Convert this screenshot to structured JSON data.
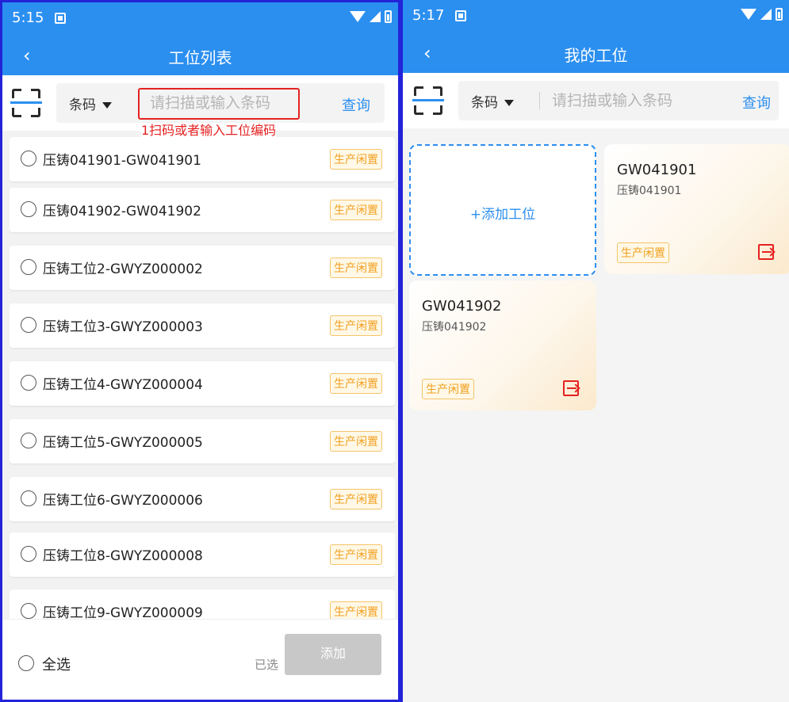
{
  "left": {
    "status": {
      "time": "5:15"
    },
    "nav": {
      "back": "‹",
      "title": "工位列表"
    },
    "search": {
      "type": "条码",
      "placeholder": "请扫描或输入条码",
      "query": "查询"
    },
    "annotation": "1扫码或者输入工位编码",
    "items": [
      {
        "label": "压铸041901-GW041901",
        "tag": "生产闲置"
      },
      {
        "label": "压铸041902-GW041902",
        "tag": "生产闲置"
      },
      {
        "label": "压铸工位2-GWYZ000002",
        "tag": "生产闲置"
      },
      {
        "label": "压铸工位3-GWYZ000003",
        "tag": "生产闲置"
      },
      {
        "label": "压铸工位4-GWYZ000004",
        "tag": "生产闲置"
      },
      {
        "label": "压铸工位5-GWYZ000005",
        "tag": "生产闲置"
      },
      {
        "label": "压铸工位6-GWYZ000006",
        "tag": "生产闲置"
      },
      {
        "label": "压铸工位8-GWYZ000008",
        "tag": "生产闲置"
      },
      {
        "label": "压铸工位9-GWYZ000009",
        "tag": "生产闲置"
      }
    ],
    "footer": {
      "select_all": "全选",
      "selected": "已选",
      "add": "添加"
    }
  },
  "right": {
    "status": {
      "time": "5:17"
    },
    "nav": {
      "back": "‹",
      "title": "我的工位"
    },
    "search": {
      "type": "条码",
      "placeholder": "请扫描或输入条码",
      "query": "查询"
    },
    "add_card": "+添加工位",
    "cards": [
      {
        "code": "GW041901",
        "name": "压铸041901",
        "tag": "生产闲置"
      },
      {
        "code": "GW041902",
        "name": "压铸041902",
        "tag": "生产闲置"
      }
    ]
  },
  "colors": {
    "primary": "#2b8ff0",
    "annotation": "#e52222",
    "tag": "#f0a020",
    "panel_border": "#2323d8"
  }
}
